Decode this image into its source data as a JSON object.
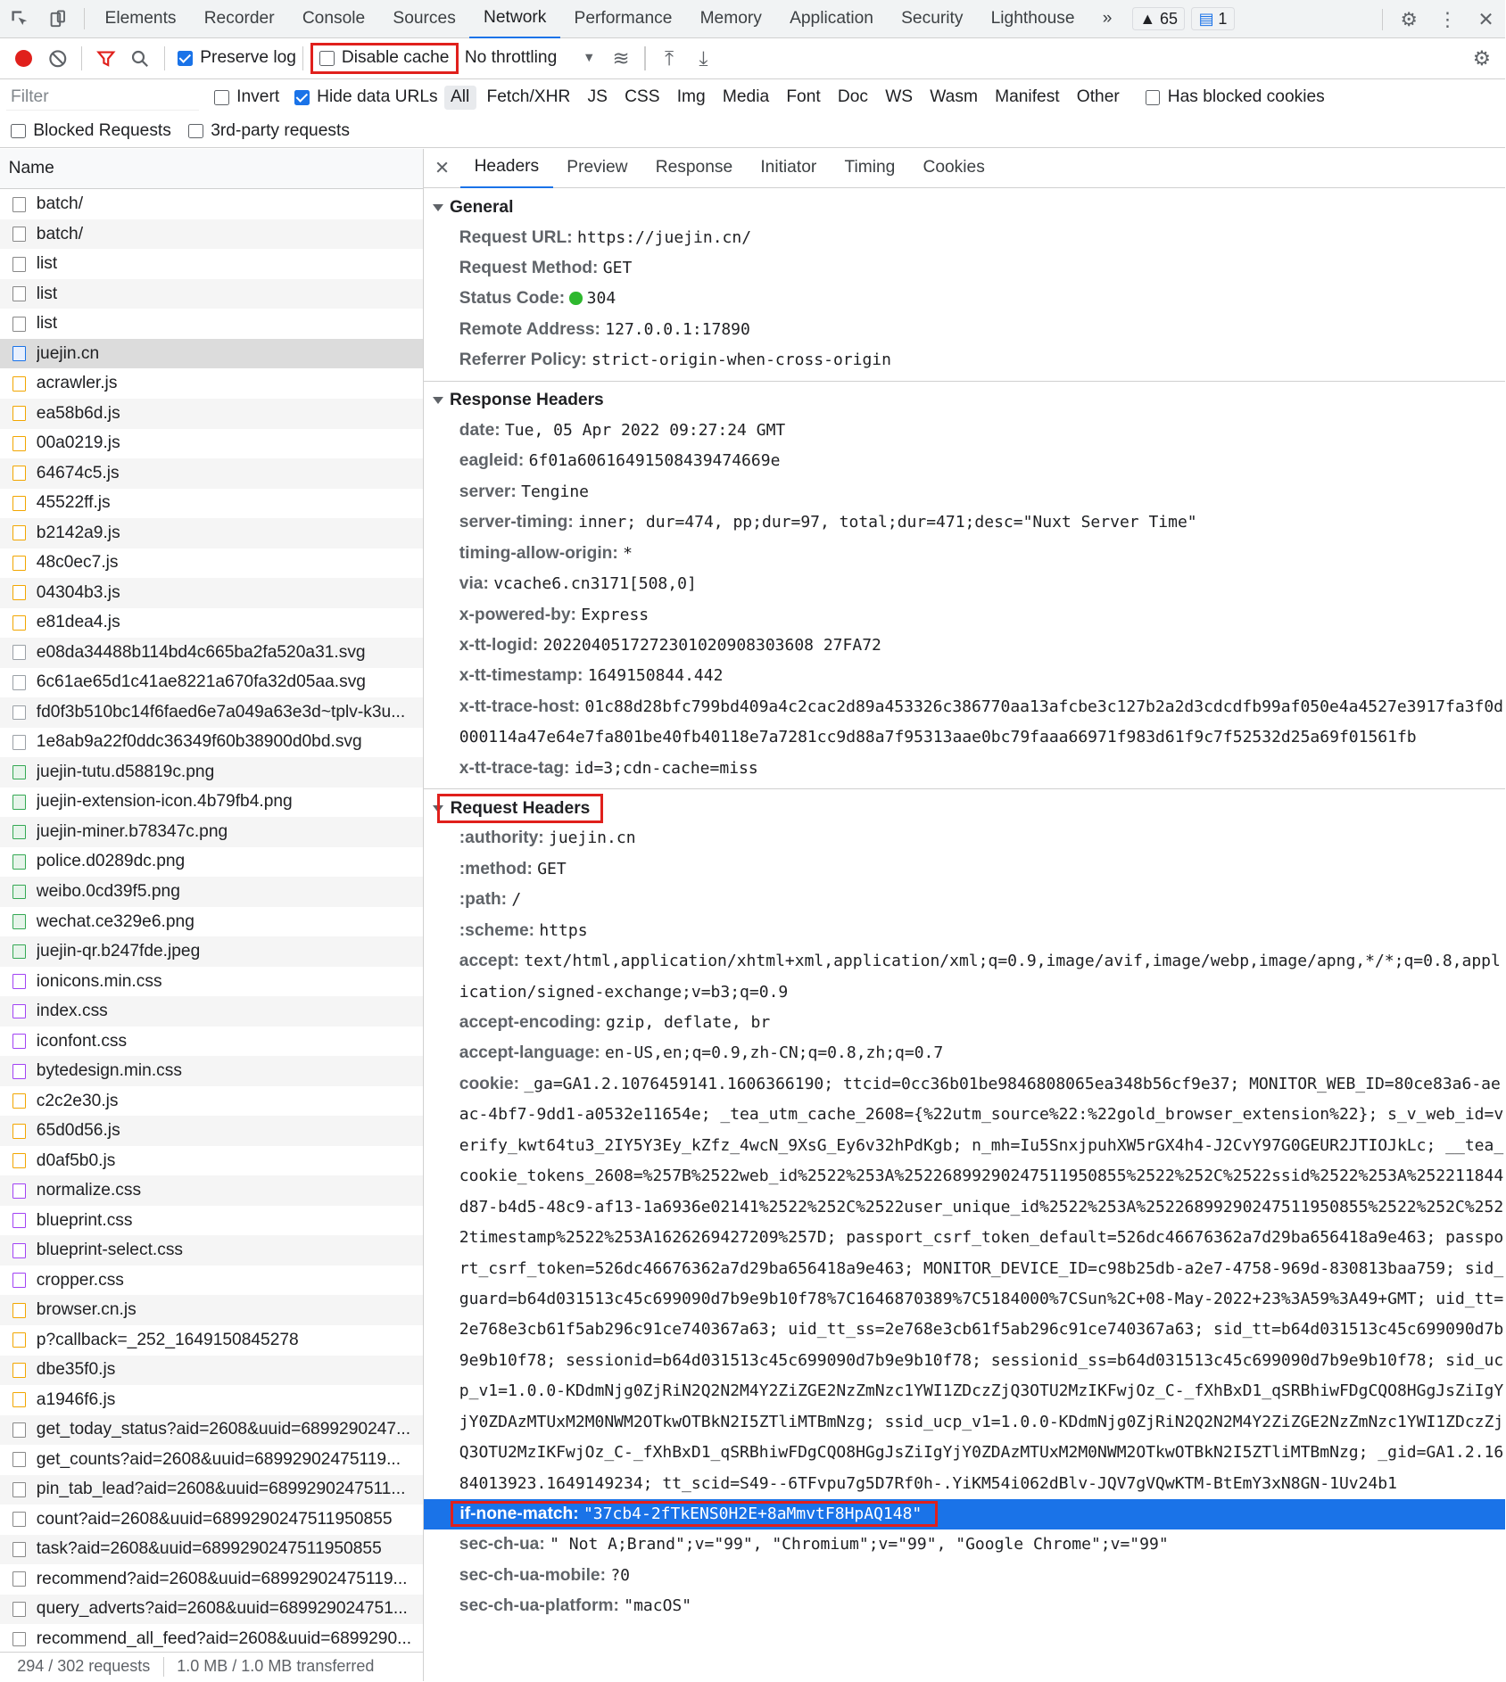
{
  "topbar": {
    "tabs": [
      "Elements",
      "Recorder",
      "Console",
      "Sources",
      "Network",
      "Performance",
      "Memory",
      "Application",
      "Security",
      "Lighthouse"
    ],
    "more": "»",
    "warnings_count": "65",
    "messages_count": "1"
  },
  "toolbar": {
    "preserve_log": "Preserve log",
    "disable_cache": "Disable cache",
    "throttling": "No throttling"
  },
  "filter": {
    "placeholder": "Filter",
    "invert": "Invert",
    "hide_data_urls": "Hide data URLs",
    "types": [
      "All",
      "Fetch/XHR",
      "JS",
      "CSS",
      "Img",
      "Media",
      "Font",
      "Doc",
      "WS",
      "Wasm",
      "Manifest",
      "Other"
    ],
    "has_blocked_cookies": "Has blocked cookies",
    "blocked_requests": "Blocked Requests",
    "third_party": "3rd-party requests"
  },
  "requests": {
    "header": "Name",
    "items": [
      {
        "name": "batch/",
        "type": "other"
      },
      {
        "name": "batch/",
        "type": "other"
      },
      {
        "name": "list",
        "type": "other"
      },
      {
        "name": "list",
        "type": "other"
      },
      {
        "name": "list",
        "type": "other"
      },
      {
        "name": "juejin.cn",
        "type": "doc"
      },
      {
        "name": "acrawler.js",
        "type": "js"
      },
      {
        "name": "ea58b6d.js",
        "type": "js"
      },
      {
        "name": "00a0219.js",
        "type": "js"
      },
      {
        "name": "64674c5.js",
        "type": "js"
      },
      {
        "name": "45522ff.js",
        "type": "js"
      },
      {
        "name": "b2142a9.js",
        "type": "js"
      },
      {
        "name": "48c0ec7.js",
        "type": "js"
      },
      {
        "name": "04304b3.js",
        "type": "js"
      },
      {
        "name": "e81dea4.js",
        "type": "js"
      },
      {
        "name": "e08da34488b114bd4c665ba2fa520a31.svg",
        "type": "svg"
      },
      {
        "name": "6c61ae65d1c41ae8221a670fa32d05aa.svg",
        "type": "svg"
      },
      {
        "name": "fd0f3b510bc14f6faed6e7a049a63e3d~tplv-k3u...",
        "type": "svg"
      },
      {
        "name": "1e8ab9a22f0ddc36349f60b38900d0bd.svg",
        "type": "svg"
      },
      {
        "name": "juejin-tutu.d58819c.png",
        "type": "img"
      },
      {
        "name": "juejin-extension-icon.4b79fb4.png",
        "type": "img"
      },
      {
        "name": "juejin-miner.b78347c.png",
        "type": "img"
      },
      {
        "name": "police.d0289dc.png",
        "type": "img"
      },
      {
        "name": "weibo.0cd39f5.png",
        "type": "img"
      },
      {
        "name": "wechat.ce329e6.png",
        "type": "img"
      },
      {
        "name": "juejin-qr.b247fde.jpeg",
        "type": "img"
      },
      {
        "name": "ionicons.min.css",
        "type": "css"
      },
      {
        "name": "index.css",
        "type": "css"
      },
      {
        "name": "iconfont.css",
        "type": "css"
      },
      {
        "name": "bytedesign.min.css",
        "type": "css"
      },
      {
        "name": "c2c2e30.js",
        "type": "js"
      },
      {
        "name": "65d0d56.js",
        "type": "js"
      },
      {
        "name": "d0af5b0.js",
        "type": "js"
      },
      {
        "name": "normalize.css",
        "type": "css"
      },
      {
        "name": "blueprint.css",
        "type": "css"
      },
      {
        "name": "blueprint-select.css",
        "type": "css"
      },
      {
        "name": "cropper.css",
        "type": "css"
      },
      {
        "name": "browser.cn.js",
        "type": "js"
      },
      {
        "name": "p?callback=_252_1649150845278",
        "type": "js"
      },
      {
        "name": "dbe35f0.js",
        "type": "js"
      },
      {
        "name": "a1946f6.js",
        "type": "js"
      },
      {
        "name": "get_today_status?aid=2608&uuid=6899290247...",
        "type": "other"
      },
      {
        "name": "get_counts?aid=2608&uuid=68992902475119...",
        "type": "other"
      },
      {
        "name": "pin_tab_lead?aid=2608&uuid=6899290247511...",
        "type": "other"
      },
      {
        "name": "count?aid=2608&uuid=6899290247511950855",
        "type": "other"
      },
      {
        "name": "task?aid=2608&uuid=6899290247511950855",
        "type": "other"
      },
      {
        "name": "recommend?aid=2608&uuid=68992902475119...",
        "type": "other"
      },
      {
        "name": "query_adverts?aid=2608&uuid=689929024751...",
        "type": "other"
      },
      {
        "name": "recommend_all_feed?aid=2608&uuid=6899290...",
        "type": "other"
      }
    ],
    "selected_index": 5,
    "status_requests": "294 / 302 requests",
    "status_transferred": "1.0 MB / 1.0 MB transferred"
  },
  "details": {
    "tabs": [
      "Headers",
      "Preview",
      "Response",
      "Initiator",
      "Timing",
      "Cookies"
    ],
    "general_title": "General",
    "general": [
      {
        "k": "Request URL:",
        "v": "https://juejin.cn/"
      },
      {
        "k": "Request Method:",
        "v": "GET"
      },
      {
        "k": "Status Code:",
        "v": "304"
      },
      {
        "k": "Remote Address:",
        "v": "127.0.0.1:17890"
      },
      {
        "k": "Referrer Policy:",
        "v": "strict-origin-when-cross-origin"
      }
    ],
    "response_title": "Response Headers",
    "response": [
      {
        "k": "date:",
        "v": "Tue, 05 Apr 2022 09:27:24 GMT"
      },
      {
        "k": "eagleid:",
        "v": "6f01a60616491508439474669e"
      },
      {
        "k": "server:",
        "v": "Tengine"
      },
      {
        "k": "server-timing:",
        "v": "inner; dur=474, pp;dur=97, total;dur=471;desc=\"Nuxt Server Time\""
      },
      {
        "k": "timing-allow-origin:",
        "v": "*"
      },
      {
        "k": "via:",
        "v": "vcache6.cn3171[508,0]"
      },
      {
        "k": "x-powered-by:",
        "v": "Express"
      },
      {
        "k": "x-tt-logid:",
        "v": "2022040517272301020908303608 27FA72"
      },
      {
        "k": "x-tt-timestamp:",
        "v": "1649150844.442"
      },
      {
        "k": "x-tt-trace-host:",
        "v": "01c88d28bfc799bd409a4c2cac2d89a453326c386770aa13afcbe3c127b2a2d3cdcdfb99af050e4a4527e3917fa3f0d000114a47e64e7fa801be40fb40118e7a7281cc9d88a7f95313aae0bc79faaa66971f983d61f9c7f52532d25a69f01561fb"
      },
      {
        "k": "x-tt-trace-tag:",
        "v": "id=3;cdn-cache=miss"
      }
    ],
    "request_title": "Request Headers",
    "request": [
      {
        "k": ":authority:",
        "v": "juejin.cn"
      },
      {
        "k": ":method:",
        "v": "GET"
      },
      {
        "k": ":path:",
        "v": "/"
      },
      {
        "k": ":scheme:",
        "v": "https"
      },
      {
        "k": "accept:",
        "v": "text/html,application/xhtml+xml,application/xml;q=0.9,image/avif,image/webp,image/apng,*/*;q=0.8,application/signed-exchange;v=b3;q=0.9"
      },
      {
        "k": "accept-encoding:",
        "v": "gzip, deflate, br"
      },
      {
        "k": "accept-language:",
        "v": "en-US,en;q=0.9,zh-CN;q=0.8,zh;q=0.7"
      },
      {
        "k": "cookie:",
        "v": "_ga=GA1.2.1076459141.1606366190; ttcid=0cc36b01be9846808065ea348b56cf9e37; MONITOR_WEB_ID=80ce83a6-aeac-4bf7-9dd1-a0532e11654e; _tea_utm_cache_2608={%22utm_source%22:%22gold_browser_extension%22}; s_v_web_id=verify_kwt64tu3_2IY5Y3Ey_kZfz_4wcN_9XsG_Ey6v32hPdKgb; n_mh=Iu5SnxjpuhXW5rGX4h4-J2CvY97G0GEUR2JTIOJkLc; __tea_cookie_tokens_2608=%257B%2522web_id%2522%253A%25226899290247511950855%2522%252C%2522ssid%2522%253A%252211844d87-b4d5-48c9-af13-1a6936e02141%2522%252C%2522user_unique_id%2522%253A%25226899290247511950855%2522%252C%2522timestamp%2522%253A1626269427209%257D; passport_csrf_token_default=526dc46676362a7d29ba656418a9e463; passport_csrf_token=526dc46676362a7d29ba656418a9e463; MONITOR_DEVICE_ID=c98b25db-a2e7-4758-969d-830813baa759; sid_guard=b64d031513c45c699090d7b9e9b10f78%7C1646870389%7C5184000%7CSun%2C+08-May-2022+23%3A59%3A49+GMT; uid_tt=2e768e3cb61f5ab296c91ce740367a63; uid_tt_ss=2e768e3cb61f5ab296c91ce740367a63; sid_tt=b64d031513c45c699090d7b9e9b10f78; sessionid=b64d031513c45c699090d7b9e9b10f78; sessionid_ss=b64d031513c45c699090d7b9e9b10f78; sid_ucp_v1=1.0.0-KDdmNjg0ZjRiN2Q2N2M4Y2ZiZGE2NzZmNzc1YWI1ZDczZjQ3OTU2MzIKFwjOz_C-_fXhBxD1_qSRBhiwFDgCQO8HGgJsZiIgYjY0ZDAzMTUxM2M0NWM2OTkwOTBkN2I5ZTliMTBmNzg; ssid_ucp_v1=1.0.0-KDdmNjg0ZjRiN2Q2N2M4Y2ZiZGE2NzZmNzc1YWI1ZDczZjQ3OTU2MzIKFwjOz_C-_fXhBxD1_qSRBhiwFDgCQO8HGgJsZiIgYjY0ZDAzMTUxM2M0NWM2OTkwOTBkN2I5ZTliMTBmNzg; _gid=GA1.2.1684013923.1649149234; tt_scid=S49--6TFvpu7g5D7Rf0h-.YiKM54i062dBlv-JQV7gVQwKTM-BtEmY3xN8GN-1Uv24b1"
      },
      {
        "k": "if-none-match:",
        "v": "\"37cb4-2fTkENS0H2E+8aMmvtF8HpAQ148\""
      },
      {
        "k": "sec-ch-ua:",
        "v": "\" Not A;Brand\";v=\"99\", \"Chromium\";v=\"99\", \"Google Chrome\";v=\"99\""
      },
      {
        "k": "sec-ch-ua-mobile:",
        "v": "?0"
      },
      {
        "k": "sec-ch-ua-platform:",
        "v": "\"macOS\""
      }
    ],
    "highlighted_request_index": 8
  },
  "colors": {
    "highlight_red": "#e0201c",
    "accent_blue": "#1a73e8",
    "status_green": "#2eb82e"
  }
}
